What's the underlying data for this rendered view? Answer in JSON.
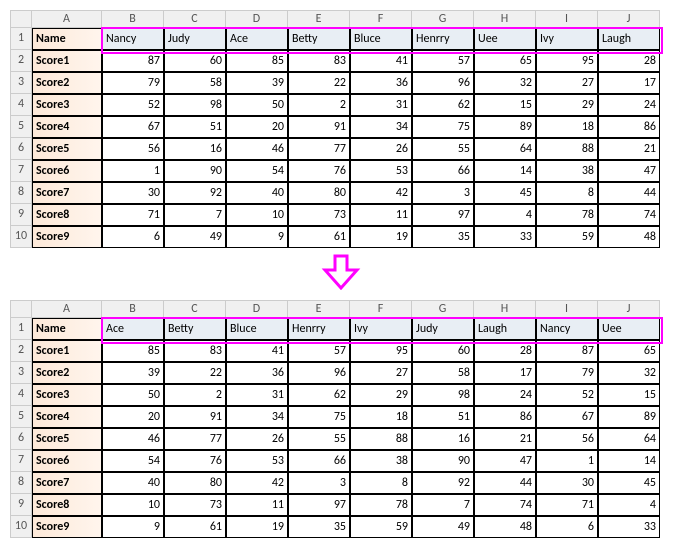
{
  "columns": [
    "A",
    "B",
    "C",
    "D",
    "E",
    "F",
    "G",
    "H",
    "I",
    "J"
  ],
  "row_numbers": [
    1,
    2,
    3,
    4,
    5,
    6,
    7,
    8,
    9,
    10
  ],
  "label_header": "Name",
  "score_labels": [
    "Score1",
    "Score2",
    "Score3",
    "Score4",
    "Score5",
    "Score6",
    "Score7",
    "Score8",
    "Score9"
  ],
  "table1": {
    "names": [
      "Nancy",
      "Judy",
      "Ace",
      "Betty",
      "Bluce",
      "Henrry",
      "Uee",
      "Ivy",
      "Laugh"
    ],
    "scores": [
      [
        87,
        60,
        85,
        83,
        41,
        57,
        65,
        95,
        28
      ],
      [
        79,
        58,
        39,
        22,
        36,
        96,
        32,
        27,
        17
      ],
      [
        52,
        98,
        50,
        2,
        31,
        62,
        15,
        29,
        24
      ],
      [
        67,
        51,
        20,
        91,
        34,
        75,
        89,
        18,
        86
      ],
      [
        56,
        16,
        46,
        77,
        26,
        55,
        64,
        88,
        21
      ],
      [
        1,
        90,
        54,
        76,
        53,
        66,
        14,
        38,
        47
      ],
      [
        30,
        92,
        40,
        80,
        42,
        3,
        45,
        8,
        44
      ],
      [
        71,
        7,
        10,
        73,
        11,
        97,
        4,
        78,
        74
      ],
      [
        6,
        49,
        9,
        61,
        19,
        35,
        33,
        59,
        48
      ]
    ]
  },
  "table2": {
    "names": [
      "Ace",
      "Betty",
      "Bluce",
      "Henrry",
      "Ivy",
      "Judy",
      "Laugh",
      "Nancy",
      "Uee"
    ],
    "scores": [
      [
        85,
        83,
        41,
        57,
        95,
        60,
        28,
        87,
        65
      ],
      [
        39,
        22,
        36,
        96,
        27,
        58,
        17,
        79,
        32
      ],
      [
        50,
        2,
        31,
        62,
        29,
        98,
        24,
        52,
        15
      ],
      [
        20,
        91,
        34,
        75,
        18,
        51,
        86,
        67,
        89
      ],
      [
        46,
        77,
        26,
        55,
        88,
        16,
        21,
        56,
        64
      ],
      [
        54,
        76,
        53,
        66,
        38,
        90,
        47,
        1,
        14
      ],
      [
        40,
        80,
        42,
        3,
        8,
        92,
        44,
        30,
        45
      ],
      [
        10,
        73,
        11,
        97,
        78,
        7,
        74,
        71,
        4
      ],
      [
        9,
        61,
        19,
        35,
        59,
        49,
        48,
        6,
        33
      ]
    ]
  },
  "chart_data": [
    {
      "type": "table",
      "title": "Unsorted scores by name",
      "columns": [
        "Name",
        "Nancy",
        "Judy",
        "Ace",
        "Betty",
        "Bluce",
        "Henrry",
        "Uee",
        "Ivy",
        "Laugh"
      ],
      "rows": [
        [
          "Score1",
          87,
          60,
          85,
          83,
          41,
          57,
          65,
          95,
          28
        ],
        [
          "Score2",
          79,
          58,
          39,
          22,
          36,
          96,
          32,
          27,
          17
        ],
        [
          "Score3",
          52,
          98,
          50,
          2,
          31,
          62,
          15,
          29,
          24
        ],
        [
          "Score4",
          67,
          51,
          20,
          91,
          34,
          75,
          89,
          18,
          86
        ],
        [
          "Score5",
          56,
          16,
          46,
          77,
          26,
          55,
          64,
          88,
          21
        ],
        [
          "Score6",
          1,
          90,
          54,
          76,
          53,
          66,
          14,
          38,
          47
        ],
        [
          "Score7",
          30,
          92,
          40,
          80,
          42,
          3,
          45,
          8,
          44
        ],
        [
          "Score8",
          71,
          7,
          10,
          73,
          11,
          97,
          4,
          78,
          74
        ],
        [
          "Score9",
          6,
          49,
          9,
          61,
          19,
          35,
          33,
          59,
          48
        ]
      ]
    },
    {
      "type": "table",
      "title": "Columns sorted alphabetically by name",
      "columns": [
        "Name",
        "Ace",
        "Betty",
        "Bluce",
        "Henrry",
        "Ivy",
        "Judy",
        "Laugh",
        "Nancy",
        "Uee"
      ],
      "rows": [
        [
          "Score1",
          85,
          83,
          41,
          57,
          95,
          60,
          28,
          87,
          65
        ],
        [
          "Score2",
          39,
          22,
          36,
          96,
          27,
          58,
          17,
          79,
          32
        ],
        [
          "Score3",
          50,
          2,
          31,
          62,
          29,
          98,
          24,
          52,
          15
        ],
        [
          "Score4",
          20,
          91,
          34,
          75,
          18,
          51,
          86,
          67,
          89
        ],
        [
          "Score5",
          46,
          77,
          26,
          55,
          88,
          16,
          21,
          56,
          64
        ],
        [
          "Score6",
          54,
          76,
          53,
          66,
          38,
          90,
          47,
          1,
          14
        ],
        [
          "Score7",
          40,
          80,
          42,
          3,
          8,
          92,
          44,
          30,
          45
        ],
        [
          "Score8",
          10,
          73,
          11,
          97,
          78,
          7,
          74,
          71,
          4
        ],
        [
          "Score9",
          9,
          61,
          19,
          35,
          59,
          49,
          48,
          6,
          33
        ]
      ]
    }
  ]
}
